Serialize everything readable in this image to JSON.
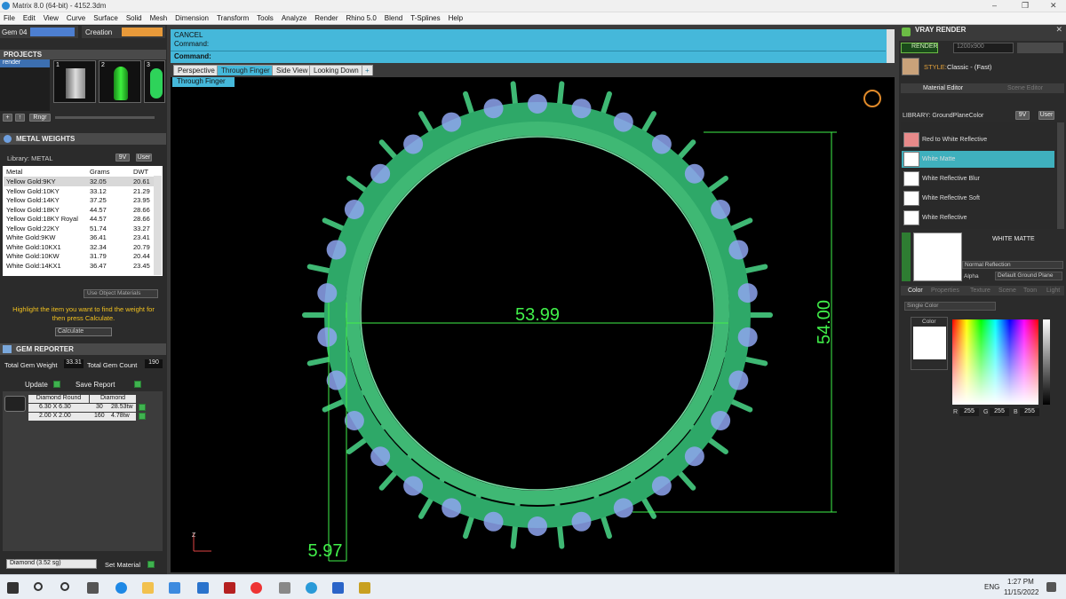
{
  "window": {
    "title": "Matrix 8.0 (64-bit) - 4152.3dm",
    "minimize": "–",
    "maximize": "❐",
    "close": "✕"
  },
  "menu": [
    "File",
    "Edit",
    "View",
    "Curve",
    "Surface",
    "Solid",
    "Mesh",
    "Dimension",
    "Transform",
    "Tools",
    "Analyze",
    "Render",
    "Rhino 5.0",
    "Blend",
    "T-Splines",
    "Help"
  ],
  "toolbar": {
    "gem_label": "Gem 04",
    "creation_label": "Creation"
  },
  "projects": {
    "title": "PROJECTS",
    "selected": "render",
    "thumbs": [
      "1",
      "2",
      "3"
    ],
    "ring_button": "Rngr"
  },
  "metal": {
    "title": "METAL WEIGHTS",
    "library_label": "Library: METAL",
    "lib_btn_9v": "9V",
    "lib_btn_user": "User",
    "columns": [
      "Metal",
      "Grams",
      "DWT"
    ],
    "rows": [
      [
        "Yellow Gold:9KY",
        "32.05",
        "20.61"
      ],
      [
        "Yellow Gold:10KY",
        "33.12",
        "21.29"
      ],
      [
        "Yellow Gold:14KY",
        "37.25",
        "23.95"
      ],
      [
        "Yellow Gold:18KY",
        "44.57",
        "28.66"
      ],
      [
        "Yellow Gold:18KY Royal",
        "44.57",
        "28.66"
      ],
      [
        "Yellow Gold:22KY",
        "51.74",
        "33.27"
      ],
      [
        "White Gold:9KW",
        "36.41",
        "23.41"
      ],
      [
        "White Gold:10KX1",
        "32.34",
        "20.79"
      ],
      [
        "White Gold:10KW",
        "31.79",
        "20.44"
      ],
      [
        "White Gold:14KX1",
        "36.47",
        "23.45"
      ]
    ],
    "use_object_materials": "Use Object Materials",
    "hint": "Highlight the item you want to find the weight for then press Calculate.",
    "calculate": "Calculate"
  },
  "gem_reporter": {
    "title": "GEM REPORTER",
    "total_weight_label": "Total Gem Weight",
    "total_weight": "33.31",
    "total_count_label": "Total Gem Count",
    "total_count": "190",
    "update": "Update",
    "save_report": "Save Report",
    "header_cut": "Diamond Round",
    "header_type": "Diamond",
    "rows": [
      {
        "size": "6.30 X 6.30",
        "count": "30",
        "ctw": "28.53tw"
      },
      {
        "size": "2.00 X 2.00",
        "count": "160",
        "ctw": "4.78tw"
      }
    ],
    "material_select": "Diamond   (3.52 sg)",
    "set_material": "Set Material"
  },
  "command": {
    "line1": "CANCEL",
    "line2": "Command:",
    "prompt": "Command:"
  },
  "view_tabs": [
    "Perspective",
    "Through Finger",
    "Side View",
    "Looking Down",
    "+"
  ],
  "active_tab": 1,
  "viewport": {
    "label": "Through Finger",
    "dim_width": "53.99",
    "dim_height": "54.00",
    "dim_band": "5.97",
    "axis_label": "Z",
    "colors": {
      "ring": "#3fb874",
      "dim": "#41f04a",
      "gem": "#8ea4f0"
    }
  },
  "vray": {
    "title": "VRAY RENDER",
    "render_btn": "RENDER",
    "resolution": "1200x900",
    "style_label": "STYLE:",
    "style_value": "Classic - (Fast)",
    "tab_material": "Material Editor",
    "tab_scene": "Scene Editor",
    "library": "LIBRARY: GroundPlaneColor",
    "lib_9v": "9V",
    "lib_user": "User",
    "materials": [
      {
        "name": "Red to White Reflective",
        "color": "#e88a8a"
      },
      {
        "name": "White Matte",
        "color": "#ffffff"
      },
      {
        "name": "White Reflective Blur",
        "color": "#ffffff"
      },
      {
        "name": "White Reflective Soft",
        "color": "#ffffff"
      },
      {
        "name": "White Reflective",
        "color": "#ffffff"
      }
    ],
    "selected_material": "WHITE MATTE",
    "reflection": "Normal Reflection",
    "alpha_label": "Alpha",
    "ground_plane": "Default Ground Plane",
    "prop_tabs": [
      "Color",
      "Properties",
      "Texture",
      "Scene",
      "Toon",
      "Light"
    ],
    "color_mode": "Single Color",
    "color_label": "Color",
    "rgb": {
      "r": "255",
      "g": "255",
      "b": "255"
    },
    "r_label": "R",
    "g_label": "G",
    "b_label": "B"
  },
  "taskbar": {
    "time": "1:27 PM",
    "date": "11/15/2022",
    "lang": "ENG"
  }
}
